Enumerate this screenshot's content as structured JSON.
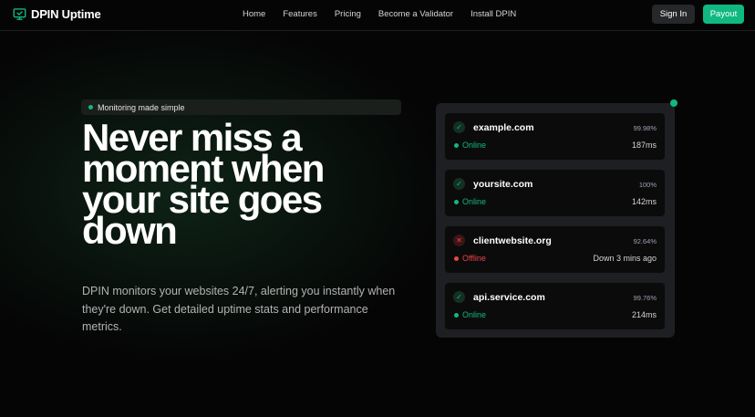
{
  "brand": {
    "name": "DPIN Uptime",
    "icon": "monitor-check-icon",
    "accent": "#10b981"
  },
  "nav": {
    "links": [
      "Home",
      "Features",
      "Pricing",
      "Become a Validator",
      "Install DPIN"
    ],
    "signin_label": "Sign In",
    "payout_label": "Payout"
  },
  "hero": {
    "badge": "Monitoring made simple",
    "headline": "Never miss a moment when your site goes down",
    "subtext": "DPIN monitors your websites 24/7, alerting you instantly when they're down. Get detailed uptime stats and performance metrics."
  },
  "monitors": [
    {
      "name": "example.com",
      "uptime": "99.98%",
      "status": "Online",
      "meta": "187ms",
      "ok": true
    },
    {
      "name": "yoursite.com",
      "uptime": "100%",
      "status": "Online",
      "meta": "142ms",
      "ok": true
    },
    {
      "name": "clientwebsite.org",
      "uptime": "92.64%",
      "status": "Offline",
      "meta": "Down 3 mins ago",
      "ok": false
    },
    {
      "name": "api.service.com",
      "uptime": "99.76%",
      "status": "Online",
      "meta": "214ms",
      "ok": true
    }
  ],
  "colors": {
    "online": "#10b981",
    "offline": "#ef4444",
    "background": "#050505"
  }
}
